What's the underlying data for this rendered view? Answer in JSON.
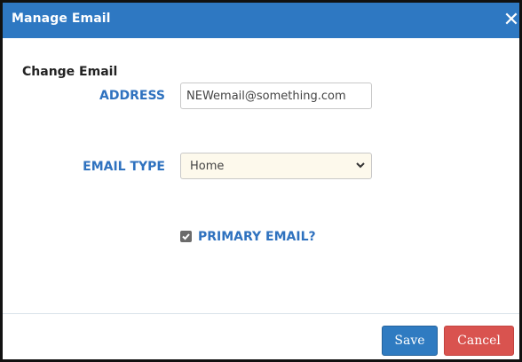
{
  "dialog": {
    "title": "Manage Email",
    "close_glyph": "✕",
    "section_heading": "Change Email",
    "address": {
      "label": "ADDRESS",
      "value": "NEWemail@something.com"
    },
    "email_type": {
      "label": "EMAIL TYPE",
      "selected": "Home"
    },
    "primary": {
      "label": "PRIMARY EMAIL?",
      "checked": true
    },
    "buttons": {
      "save": "Save",
      "cancel": "Cancel"
    },
    "colors": {
      "titlebar": "#2e78c2",
      "label": "#2f72bf",
      "save": "#2f7bc1",
      "cancel": "#d9534f",
      "select_bg": "#fdf9ec"
    },
    "icons": {
      "close": "close-icon",
      "dropdown": "chevron-down-icon",
      "checkbox": "checkmark-icon"
    }
  }
}
